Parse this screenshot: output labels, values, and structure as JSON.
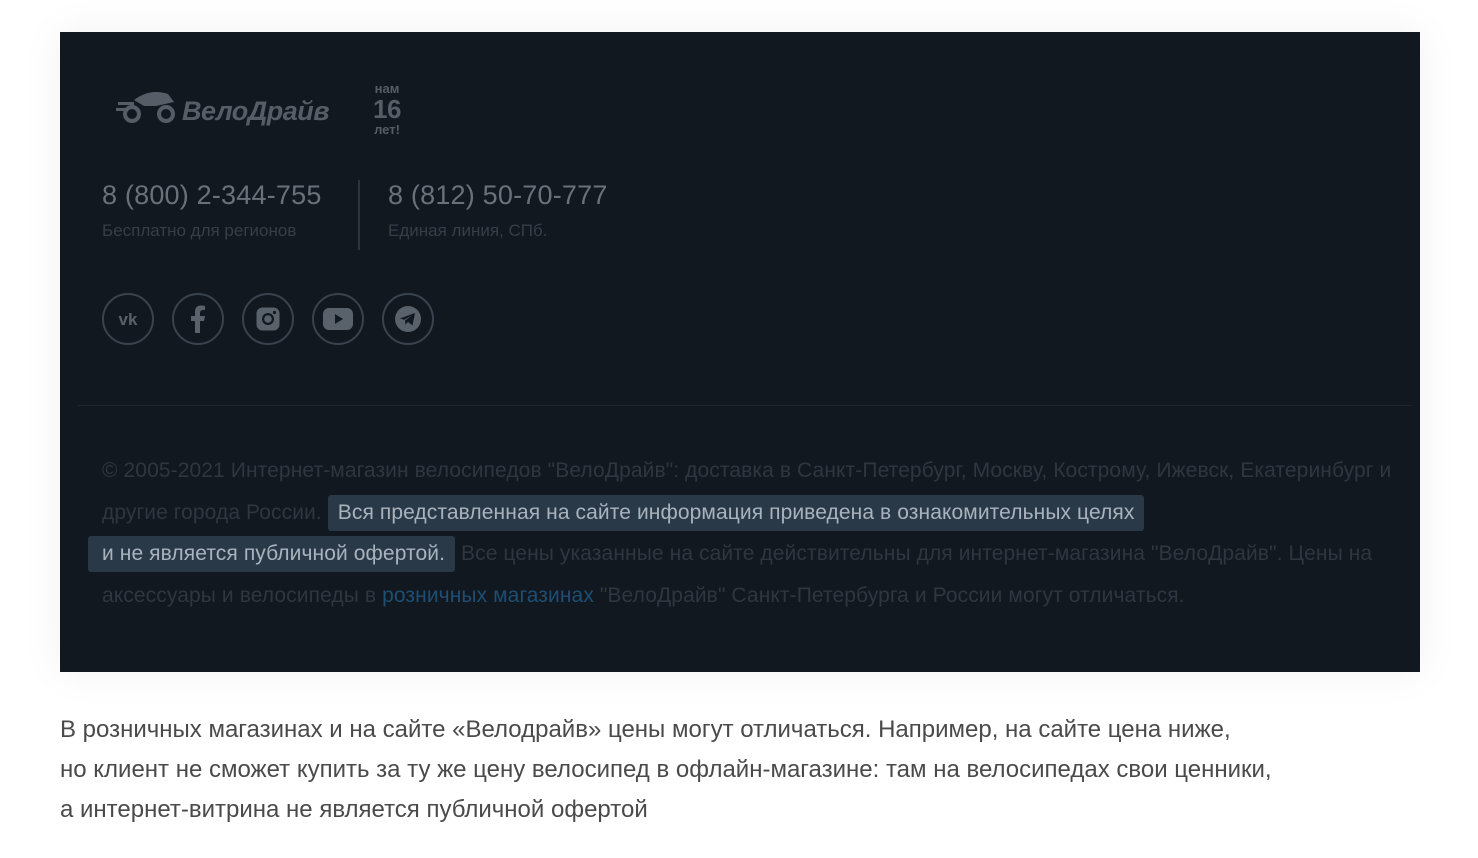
{
  "screenshot": {
    "logo": {
      "name": "ВелоДрайв",
      "badge_top": "нам",
      "badge_num": "16",
      "badge_bottom": "лет!"
    },
    "phones": [
      {
        "number": "8 (800) 2-344-755",
        "caption": "Бесплатно для регионов"
      },
      {
        "number": "8 (812) 50-70-777",
        "caption": "Единая линия, СПб."
      }
    ],
    "socials": [
      "vk-icon",
      "facebook-icon",
      "instagram-icon",
      "youtube-icon",
      "telegram-icon"
    ],
    "legal": {
      "part1": "© 2005-2021 Интернет-магазин велосипедов \"ВелоДрайв\": доставка в Санкт-Петербург, Москву, Кострому, Ижевск, Екатеринбург и другие города России.",
      "highlight_1": "Вся представленная на сайте информация приведена в ознакомительных целях",
      "highlight_2": "и не является публичной офертой.",
      "part2": "Все цены указанные на сайте действительны для интернет-магазина \"ВелоДрайв\". Цены на аксессуары и велосипеды в",
      "link": "розничных магазинах",
      "part3": "\"ВелоДрайв\" Санкт-Петербурга и России могут отличаться."
    },
    "colors": {
      "background": "#111820",
      "highlight": "#2a3947",
      "link": "#1f4e73"
    }
  },
  "caption": {
    "line1": "В розничных магазинах и на сайте «Велодрайв» цены могут отличаться. Например, на сайте цена ниже,",
    "line2": "но клиент не сможет купить за ту же цену велосипед в офлайн-магазине: там на велосипедах свои ценники,",
    "line3": "а интернет-витрина не является публичной офертой"
  }
}
